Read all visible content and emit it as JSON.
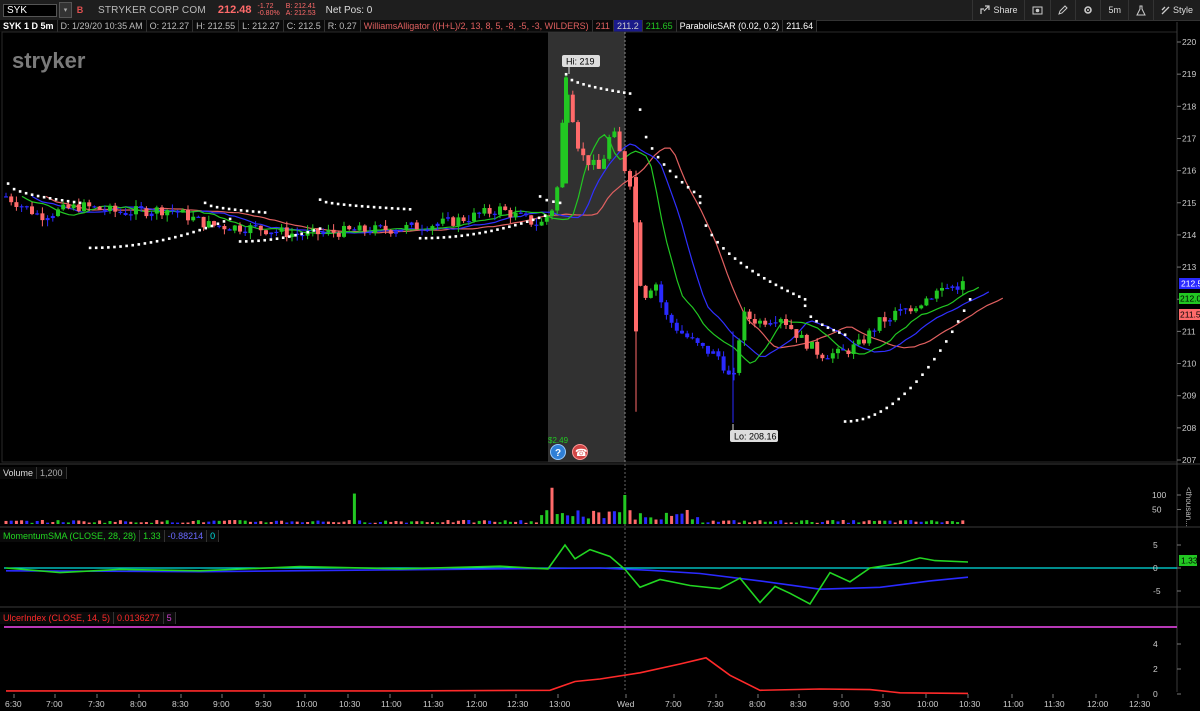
{
  "toolbar": {
    "symbol": "SYK",
    "company": "STRYKER CORP COM",
    "last": "212.48",
    "change": "-1.72",
    "change_pct": "-0.80%",
    "bid": "B: 212.41",
    "ask": "A: 212.53",
    "net_pos": "Net Pos: 0",
    "share_label": "Share",
    "timeframe_label": "5m",
    "style_label": "Style"
  },
  "header": {
    "symbol_tf": "SYK 1 D 5m",
    "date": "D: 1/29/20 10:35 AM",
    "open": "O: 212.27",
    "high": "H: 212.55",
    "low": "L: 212.27",
    "close": "C: 212.5",
    "range": "R: 0.27",
    "alligator": "WilliamsAlligator ((H+L)/2, 13, 8, 5, -8, -5, -3, WILDERS)",
    "alligator_v1": "211",
    "alligator_v2": "211.2",
    "alligator_v3": "211.65",
    "psar": "ParabolicSAR (0.02, 0.2)",
    "psar_v": "211.64"
  },
  "logo_text": "stryker",
  "annotations": {
    "hi": "Hi: 219",
    "lo": "Lo: 208.16",
    "earnings": "$2.49"
  },
  "price_axis": {
    "ticks": [
      "220",
      "219",
      "218",
      "217",
      "216",
      "215",
      "214",
      "213",
      "212",
      "211",
      "210",
      "209",
      "208",
      "207"
    ],
    "labels": {
      "last": "212.5",
      "green": "212.01",
      "red": "211.52"
    }
  },
  "volume": {
    "title": "Volume",
    "value": "1,200",
    "ticks": [
      "100",
      "50"
    ],
    "unit": "<thousan..."
  },
  "momentum": {
    "title": "MomentumSMA (CLOSE, 28, 28)",
    "v1": "1.33",
    "v2": "-0.88214",
    "v3": "0",
    "ticks": [
      "5",
      "0",
      "-5"
    ],
    "label": "1.33"
  },
  "ulcer": {
    "title": "UlcerIndex (CLOSE, 14, 5)",
    "v1": "0.0136277",
    "v2": "5",
    "ticks": [
      "4",
      "2",
      "0"
    ]
  },
  "time_axis": [
    "6:30",
    "7:00",
    "7:30",
    "8:00",
    "8:30",
    "9:00",
    "9:30",
    "10:00",
    "10:30",
    "11:00",
    "11:30",
    "12:00",
    "12:30",
    "13:00",
    "Wed",
    "7:00",
    "7:30",
    "8:00",
    "8:30",
    "9:00",
    "9:30",
    "10:00",
    "10:30",
    "11:00",
    "11:30",
    "12:00",
    "12:30"
  ],
  "colors": {
    "up": "#22c722",
    "down": "#ff6a6a",
    "neutral": "#2a2aff",
    "psar": "#ffffff",
    "jaw": "#e06060",
    "teeth": "#3030ff",
    "lips": "#22c722",
    "ulcer": "#ff2a2a",
    "ulcer_level": "#d040d0",
    "zero": "#00e0e0"
  },
  "chart_data": {
    "type": "candlestick",
    "ylim": [
      207,
      220
    ],
    "grid": false
  }
}
